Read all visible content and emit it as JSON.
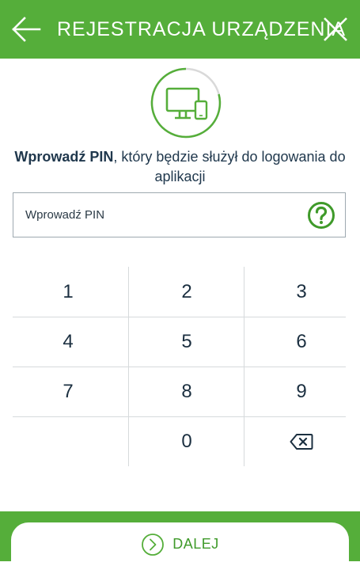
{
  "header": {
    "title": "REJESTRACJA URZĄDZENIA",
    "back_icon": "arrow-left-icon",
    "close_icon": "close-icon"
  },
  "status_icon": "device-registration-icon",
  "instruction": {
    "bold": "Wprowadź PIN",
    "rest": ", który będzie służył do logowania do aplikacji"
  },
  "pin_input": {
    "placeholder": "Wprowadź PIN",
    "value": "",
    "help_icon": "question-mark-icon"
  },
  "keypad": {
    "keys": [
      "1",
      "2",
      "3",
      "4",
      "5",
      "6",
      "7",
      "8",
      "9",
      "0"
    ],
    "backspace_icon": "backspace-icon"
  },
  "footer": {
    "next_label": "DALEJ",
    "next_icon": "chevron-right-circle-icon"
  },
  "colors": {
    "brand_green": "#55ae3a",
    "text_dark": "#1f3347",
    "divider": "#d6dadc"
  }
}
